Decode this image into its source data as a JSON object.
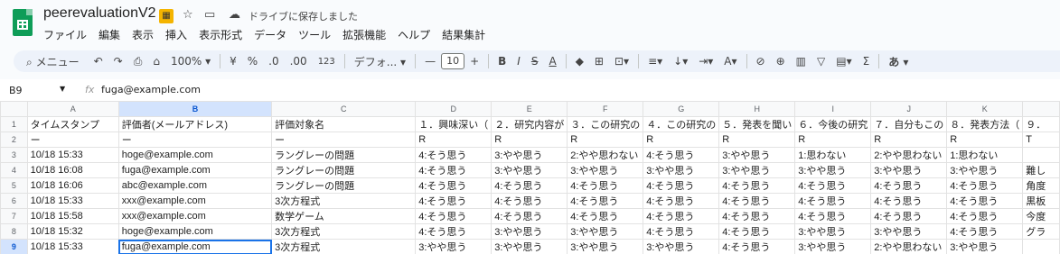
{
  "doc": {
    "title": "peerevaluationV2",
    "saved_status": "ドライブに保存しました"
  },
  "menu": [
    "ファイル",
    "編集",
    "表示",
    "挿入",
    "表示形式",
    "データ",
    "ツール",
    "拡張機能",
    "ヘルプ",
    "結果集計"
  ],
  "toolbar": {
    "search": "メニュー",
    "zoom": "100%",
    "currency": "¥",
    "percent": "%",
    "dec_dec": ".0",
    "inc_dec": ".00",
    "number_fmt": "123",
    "font": "デフォ...",
    "font_size": "10",
    "input_tool": "あ"
  },
  "formula_bar": {
    "cell_ref": "B9",
    "fx": "fx",
    "value": "fuga@example.com"
  },
  "columns": [
    "A",
    "B",
    "C",
    "D",
    "E",
    "F",
    "G",
    "H",
    "I",
    "J",
    "K",
    ""
  ],
  "rows": [
    {
      "n": "1",
      "cells": [
        "タイムスタンプ",
        "評価者(メールアドレス)",
        "評価対象名",
        "１．興味深い（",
        "２．研究内容が",
        "３．この研究の",
        "４．この研究の",
        "５．発表を聞い",
        "６．今後の研究",
        "７．自分もこの",
        "８．発表方法（",
        "９．"
      ]
    },
    {
      "n": "2",
      "cells": [
        "ー",
        "ー",
        "ー",
        "R",
        "R",
        "R",
        "R",
        "R",
        "R",
        "R",
        "R",
        "T"
      ]
    },
    {
      "n": "3",
      "cells": [
        "10/18 15:33",
        "hoge@example.com",
        "ラングレーの問題",
        "4:そう思う",
        "3:やや思う",
        "2:やや思わない",
        "4:そう思う",
        "3:やや思う",
        "1:思わない",
        "2:やや思わない",
        "1:思わない",
        ""
      ]
    },
    {
      "n": "4",
      "cells": [
        "10/18 16:08",
        "fuga@example.com",
        "ラングレーの問題",
        "4:そう思う",
        "3:やや思う",
        "3:やや思う",
        "3:やや思う",
        "3:やや思う",
        "3:やや思う",
        "3:やや思う",
        "3:やや思う",
        "難し"
      ]
    },
    {
      "n": "5",
      "cells": [
        "10/18 16:06",
        "abc@example.com",
        "ラングレーの問題",
        "4:そう思う",
        "4:そう思う",
        "4:そう思う",
        "4:そう思う",
        "4:そう思う",
        "4:そう思う",
        "4:そう思う",
        "4:そう思う",
        "角度"
      ]
    },
    {
      "n": "6",
      "cells": [
        "10/18 15:33",
        "xxx@example.com",
        "3次方程式",
        "4:そう思う",
        "4:そう思う",
        "4:そう思う",
        "4:そう思う",
        "4:そう思う",
        "4:そう思う",
        "4:そう思う",
        "4:そう思う",
        "黒板"
      ]
    },
    {
      "n": "7",
      "cells": [
        "10/18 15:58",
        "xxx@example.com",
        "数学ゲーム",
        "4:そう思う",
        "4:そう思う",
        "4:そう思う",
        "4:そう思う",
        "4:そう思う",
        "4:そう思う",
        "4:そう思う",
        "4:そう思う",
        "今度"
      ]
    },
    {
      "n": "8",
      "cells": [
        "10/18 15:32",
        "hoge@example.com",
        "3次方程式",
        "4:そう思う",
        "3:やや思う",
        "3:やや思う",
        "4:そう思う",
        "4:そう思う",
        "3:やや思う",
        "3:やや思う",
        "4:そう思う",
        "グラ"
      ]
    },
    {
      "n": "9",
      "cells": [
        "10/18 15:33",
        "fuga@example.com",
        "3次方程式",
        "3:やや思う",
        "3:やや思う",
        "3:やや思う",
        "3:やや思う",
        "4:そう思う",
        "3:やや思う",
        "2:やや思わない",
        "3:やや思う",
        ""
      ]
    }
  ]
}
